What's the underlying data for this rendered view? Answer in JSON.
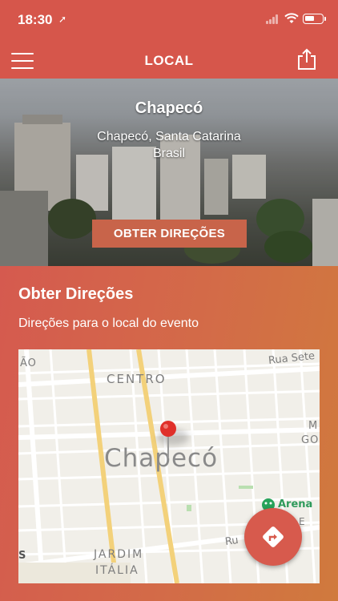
{
  "status_bar": {
    "time": "18:30",
    "location_glyph": "➚"
  },
  "nav": {
    "title": "LOCAL",
    "menu_icon": "hamburger-icon",
    "share_icon": "share-icon"
  },
  "hero": {
    "city": "Chapecó",
    "address_line1": "Chapecó, Santa Catarina",
    "address_line2": "Brasil",
    "directions_button": "OBTER DIREÇÕES"
  },
  "directions": {
    "heading": "Obter Direções",
    "subtitle": "Direções para o local do evento",
    "map": {
      "city_label": "Chapecó",
      "district_centro": "CENTRO",
      "district_jardim": "JARDIM",
      "district_italia": "ITÁLIA",
      "street_sete": "Rua Sete",
      "street_ru": "Ru",
      "edge_ao": "ÃO",
      "edge_m": "M",
      "edge_go": "GO",
      "edge_s": "S",
      "poi_arena": "Arena",
      "poi_e": "E"
    },
    "fab_icon": "directions-icon"
  },
  "colors": {
    "brand": "#d6564b",
    "button": "#c8644a",
    "card_end": "#d07a3d",
    "pin": "#e0302a"
  }
}
